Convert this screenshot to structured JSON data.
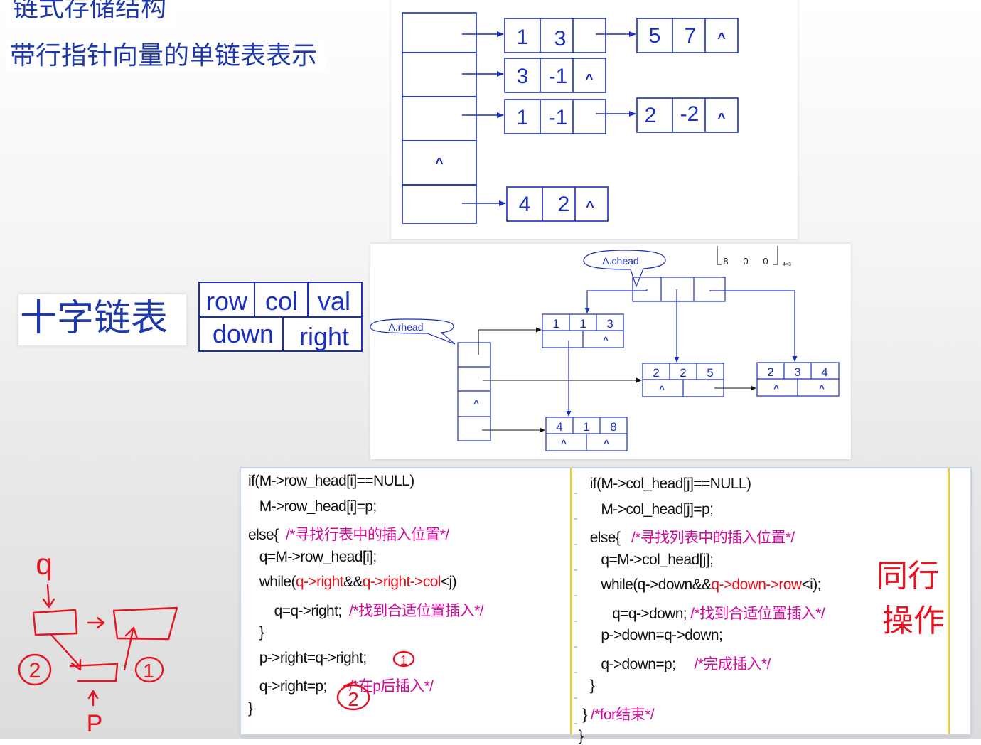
{
  "titles": {
    "t1": "链式存储结构",
    "t2": "带行指针向量的单链表表示",
    "t3": "十字链表"
  },
  "node_fields": {
    "row": "row",
    "col": "col",
    "val": "val",
    "down": "down",
    "right": "right"
  },
  "diagram1": {
    "null_symbol": "^",
    "nodes": [
      {
        "a": "1",
        "b": "3"
      },
      {
        "a": "5",
        "b": "7"
      },
      {
        "a": "3",
        "b": "-1"
      },
      {
        "a": "1",
        "b": "-1"
      },
      {
        "a": "2",
        "b": "-2"
      },
      {
        "a": "4",
        "b": "2"
      }
    ]
  },
  "diagram2": {
    "chead_label": "A.chead",
    "rhead_label": "A.rhead",
    "matrix_fragment": {
      "values": [
        "8",
        "0",
        "0"
      ],
      "subscript": "4×3"
    },
    "null_symbol": "^",
    "nodes": [
      {
        "r": "1",
        "c": "1",
        "v": "3"
      },
      {
        "r": "2",
        "c": "2",
        "v": "5"
      },
      {
        "r": "2",
        "c": "3",
        "v": "4"
      },
      {
        "r": "4",
        "c": "1",
        "v": "8"
      }
    ]
  },
  "code": {
    "left": [
      [
        {
          "t": "if(M->row_head[i]==NULL)"
        }
      ],
      [
        {
          "t": "   M->row_head[i]=p;"
        }
      ],
      [
        {
          "t": "else{  "
        },
        {
          "t": "/*寻找行表中的插入位置*/",
          "s": "com"
        }
      ],
      [
        {
          "t": "   q=M->row_head[i];"
        }
      ],
      [
        {
          "t": "   while("
        },
        {
          "t": "q->right",
          "s": "red"
        },
        {
          "t": "&&"
        },
        {
          "t": "q->right->col",
          "s": "red"
        },
        {
          "t": "<j)"
        }
      ],
      [
        {
          "t": "       q=q->right;  "
        },
        {
          "t": "/*找到合适位置插入*/",
          "s": "com"
        }
      ],
      [
        {
          "t": "   }"
        }
      ],
      [
        {
          "t": "   p->right=q->right;"
        }
      ],
      [
        {
          "t": "   q->right=p;      "
        },
        {
          "t": "/*在p后插入*/",
          "s": "com"
        }
      ],
      [
        {
          "t": "}"
        }
      ]
    ],
    "right": [
      [
        {
          "t": "   if(M->col_head[j]==NULL)"
        }
      ],
      [
        {
          "t": "      M->col_head[j]=p;"
        }
      ],
      [
        {
          "t": "   else{   "
        },
        {
          "t": "/*寻找列表中的插入位置*/",
          "s": "com"
        }
      ],
      [
        {
          "t": "      q=M->col_head[j];"
        }
      ],
      [
        {
          "t": "      while(q->down&&"
        },
        {
          "t": "q->down->row",
          "s": "red"
        },
        {
          "t": "<i);"
        }
      ],
      [
        {
          "t": "         q=q->down; "
        },
        {
          "t": "/*找到合适位置插入*/",
          "s": "com"
        }
      ],
      [
        {
          "t": "      p->down=q->down;"
        }
      ],
      [
        {
          "t": "      q->down=p;     "
        },
        {
          "t": "/*完成插入*/",
          "s": "com"
        }
      ],
      [
        {
          "t": "   }"
        }
      ],
      [
        {
          "t": " } "
        },
        {
          "t": "/*for结束*/",
          "s": "com"
        }
      ],
      [
        {
          "t": "}"
        }
      ]
    ]
  },
  "annotations": {
    "same_row": "同行",
    "operate": "操作",
    "q": "q",
    "p": "P",
    "circled_1": "1",
    "circled_2": "2",
    "ink_color": "#e51420"
  },
  "colors": {
    "title_blue": "#1f3aa8",
    "diagram_blue": "#1a2fbf",
    "comment_magenta": "#d30a9c",
    "code_red": "#e8101a"
  }
}
